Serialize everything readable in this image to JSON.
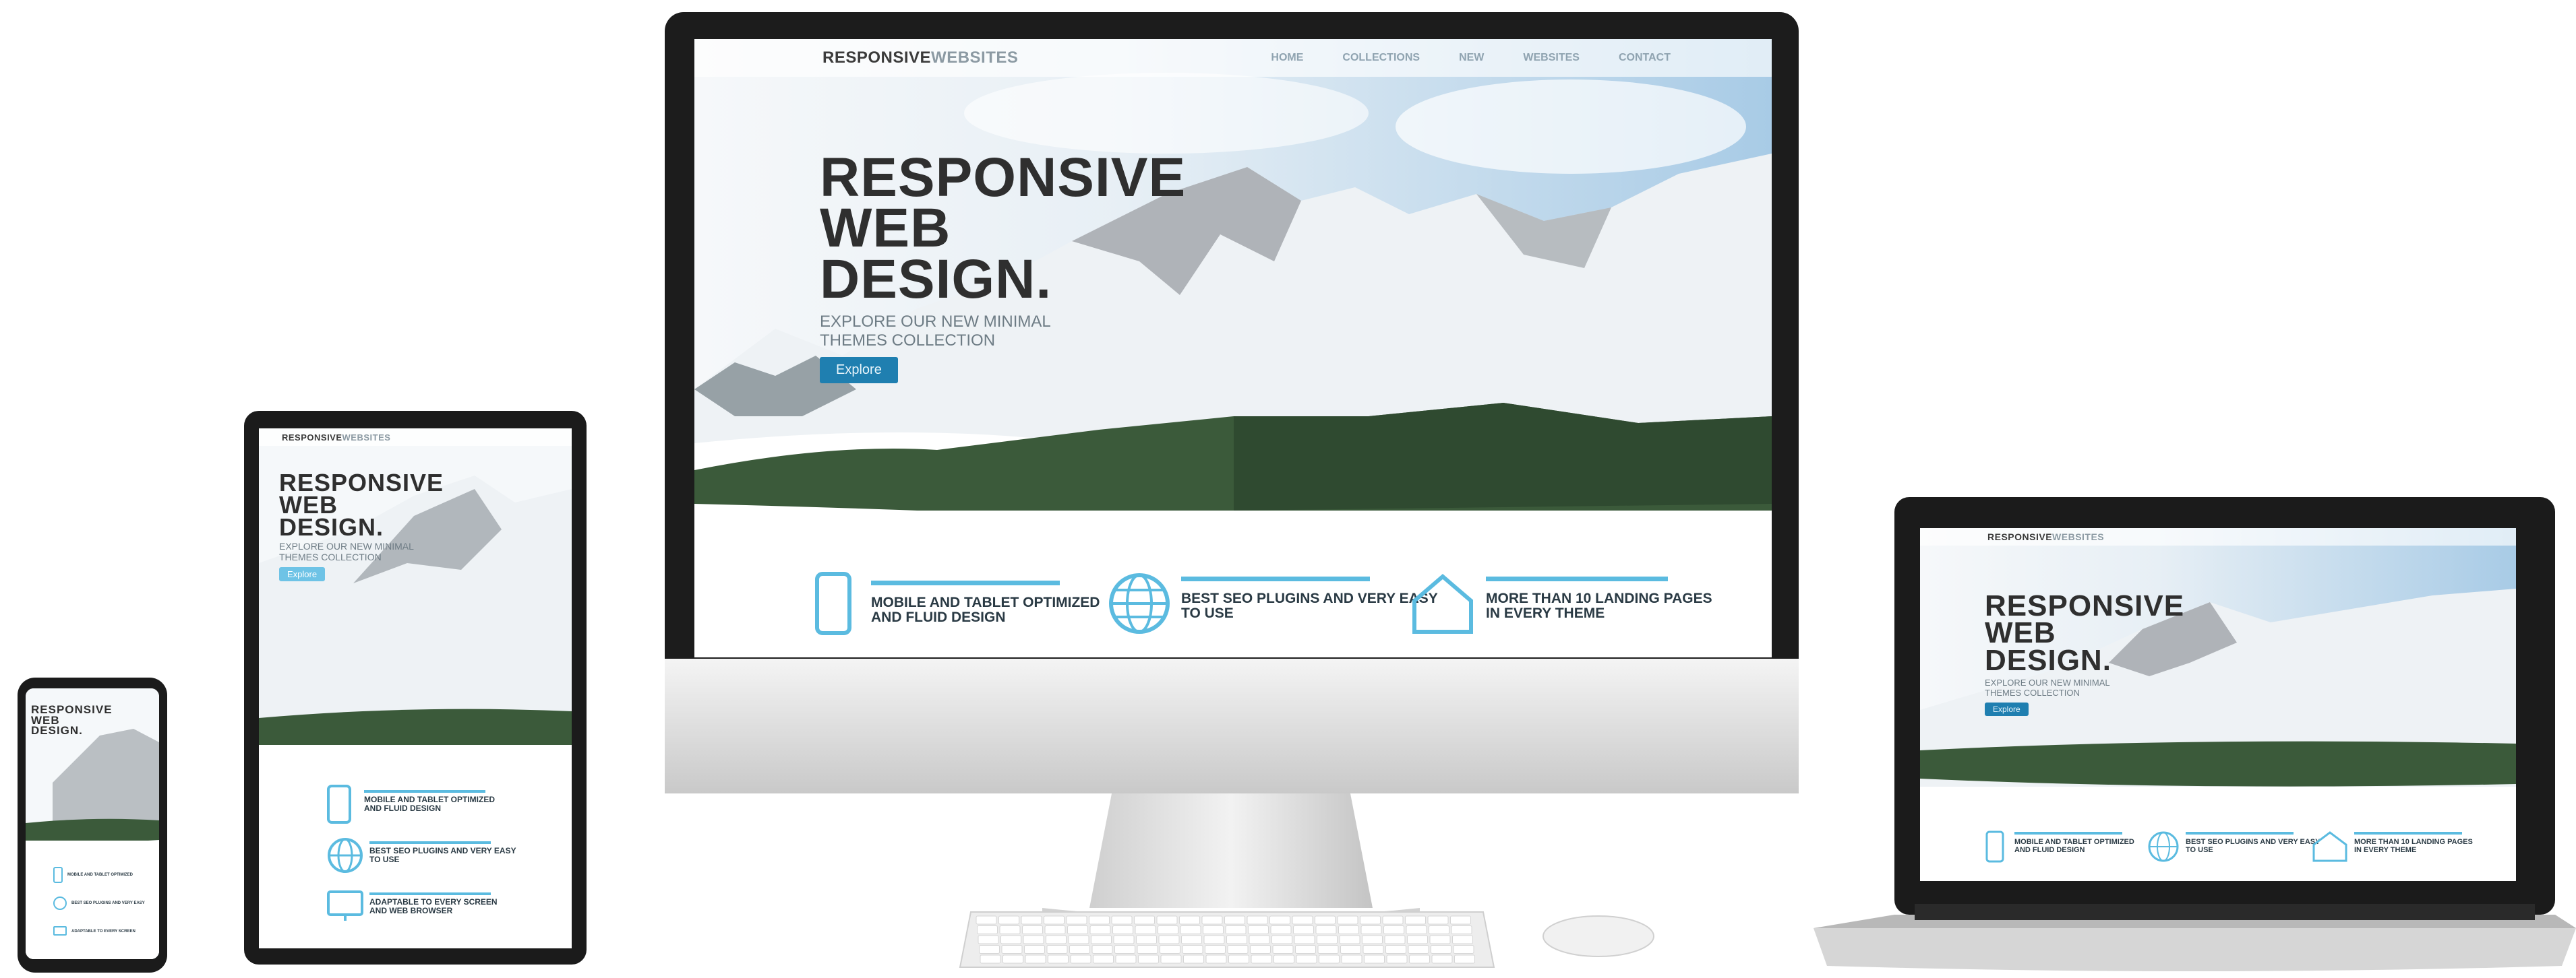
{
  "site": {
    "brand_primary": "RESPONSIVE",
    "brand_secondary": "WEBSITES",
    "nav": [
      "HOME",
      "COLLECTIONS",
      "NEW",
      "WEBSITES",
      "CONTACT"
    ],
    "hero_line1": "RESPONSIVE",
    "hero_line2": "WEB",
    "hero_line3": "DESIGN.",
    "hero_sub_line1": "EXPLORE OUR NEW MINIMAL",
    "hero_sub_line2": "THEMES COLLECTION",
    "explore_label": "Explore",
    "features": [
      {
        "icon": "tablet-icon",
        "line1": "MOBILE AND TABLET OPTIMIZED",
        "line2": "AND FLUID DESIGN"
      },
      {
        "icon": "globe-icon",
        "line1": "BEST SEO PLUGINS AND VERY EASY",
        "line2": "TO USE"
      },
      {
        "icon": "home-icon",
        "line1": "MORE THAN 10 LANDING PAGES",
        "line2": "IN EVERY THEME"
      }
    ],
    "tablet_feature3": {
      "icon": "monitor-icon",
      "line1": "ADAPTABLE TO EVERY SCREEN",
      "line2": "AND WEB BROWSER"
    }
  },
  "colors": {
    "accent": "#5bbbe0",
    "button": "#1f7fb0",
    "device_dark": "#1b1b1b",
    "device_silver": "#d9d9d9"
  }
}
